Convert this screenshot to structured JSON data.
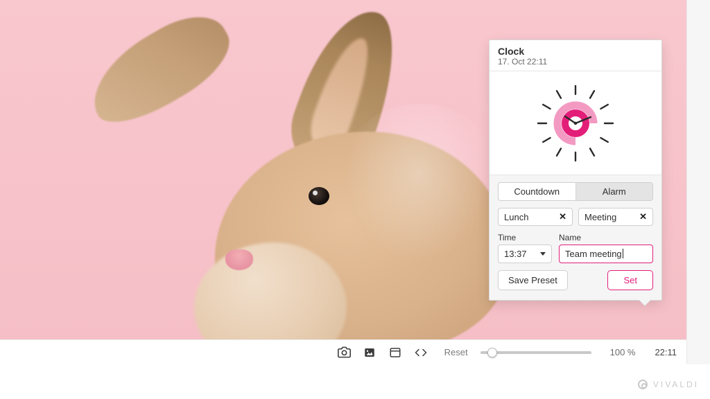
{
  "popup": {
    "title": "Clock",
    "subtitle": "17. Oct 22:11",
    "tabs": {
      "countdown": "Countdown",
      "alarm": "Alarm",
      "active": "alarm"
    },
    "presets": [
      {
        "label": "Lunch"
      },
      {
        "label": "Meeting"
      }
    ],
    "fields": {
      "time_label": "Time",
      "time_value": "13:37",
      "name_label": "Name",
      "name_value": "Team meeting"
    },
    "actions": {
      "save_preset": "Save Preset",
      "set": "Set"
    },
    "accent": "#e31e79"
  },
  "statusbar": {
    "reset": "Reset",
    "zoom": "100 %",
    "clock": "22:11"
  },
  "brand": "VIVALDI"
}
